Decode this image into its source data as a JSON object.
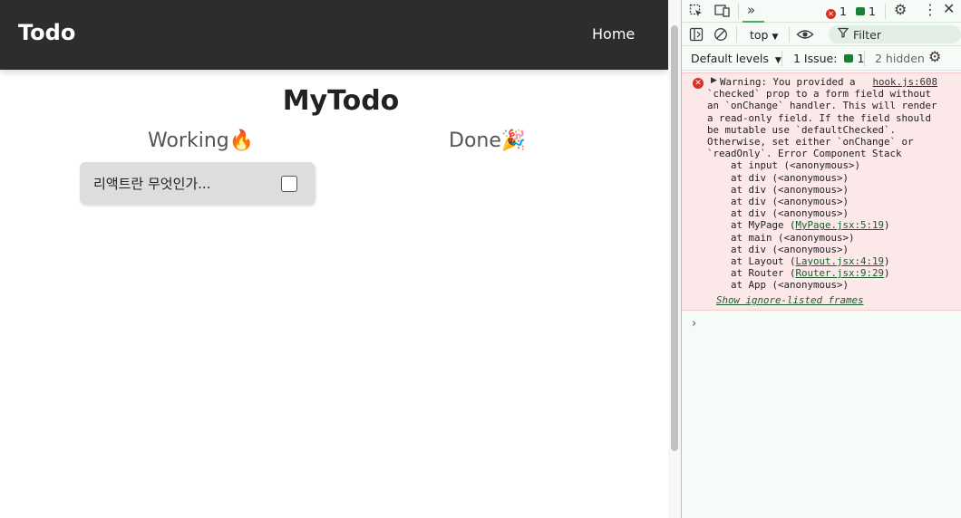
{
  "app": {
    "brand": "Todo",
    "nav_home": "Home",
    "page_title": "MyTodo",
    "working_title": "Working🔥",
    "done_title": "Done🎉",
    "todos": [
      {
        "text": "리액트란 무엇인가...",
        "checked": false
      }
    ]
  },
  "devtools": {
    "error_count": "1",
    "message_count": "1",
    "context": "top",
    "filter_placeholder": "Filter",
    "levels": "Default levels",
    "issues_label": "1 Issue:",
    "issues_count": "1",
    "hidden": "2 hidden",
    "warning": {
      "text": "Warning: You provided a\n`checked` prop to a form field without\nan `onChange` handler. This will render\na read-only field. If the field should\nbe mutable use `defaultChecked`.\nOtherwise, set either `onChange` or\n`readOnly`. Error Component Stack",
      "source": "hook.js:608",
      "stack": [
        {
          "text": "at input (<anonymous>)"
        },
        {
          "text": "at div (<anonymous>)"
        },
        {
          "text": "at div (<anonymous>)"
        },
        {
          "text": "at div (<anonymous>)"
        },
        {
          "text": "at div (<anonymous>)"
        },
        {
          "text": "at MyPage (",
          "link": "MyPage.jsx:5:19",
          "after": ")"
        },
        {
          "text": "at main (<anonymous>)"
        },
        {
          "text": "at div (<anonymous>)"
        },
        {
          "text": "at Layout (",
          "link": "Layout.jsx:4:19",
          "after": ")"
        },
        {
          "text": "at Router (",
          "link": "Router.jsx:9:29",
          "after": ")"
        },
        {
          "text": "at App (<anonymous>)"
        }
      ],
      "show_ignored": "Show ignore-listed frames"
    },
    "prompt": "›"
  }
}
